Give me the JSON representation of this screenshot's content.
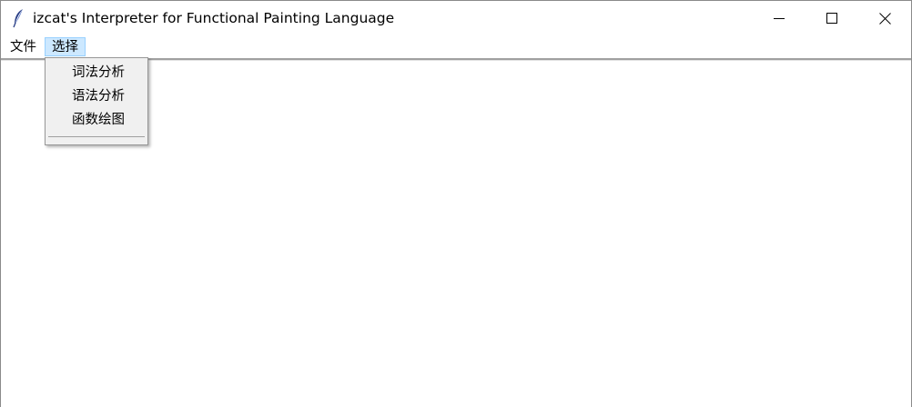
{
  "window": {
    "title": "izcat's Interpreter for Functional Painting Language",
    "icon": "feather-icon",
    "controls": [
      "minimize-icon",
      "maximize-icon",
      "close-icon"
    ]
  },
  "menubar": {
    "items": [
      {
        "label": "文件"
      },
      {
        "label": "选择",
        "active": true
      }
    ]
  },
  "dropdown": {
    "items": [
      {
        "label": "词法分析"
      },
      {
        "label": "语法分析"
      },
      {
        "label": "函数绘图"
      }
    ]
  },
  "colors": {
    "menu_highlight": "#cce8ff",
    "menu_highlight_border": "#99d1ff",
    "dropdown_bg": "#f0f0f0"
  }
}
